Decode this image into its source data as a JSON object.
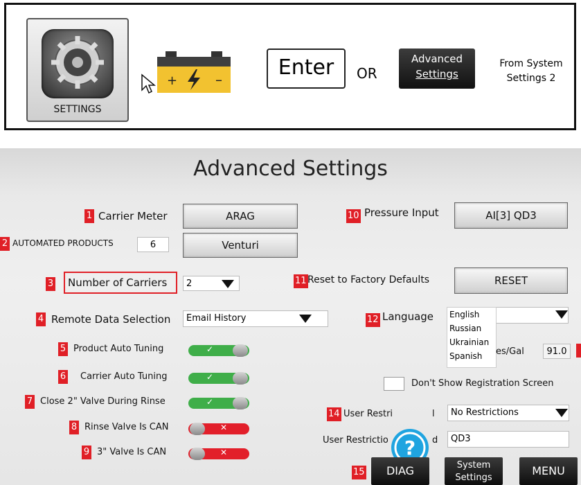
{
  "instructions": {
    "settings_tile_label": "SETTINGS",
    "enter_key": "Enter",
    "or_label": "OR",
    "advanced_btn_line1": "Advanced",
    "advanced_btn_line2": "Settings",
    "from_system_line1": "From System",
    "from_system_line2": "Settings 2",
    "icons": [
      "settings-gear-icon",
      "cursor-arrow-icon",
      "battery-icon"
    ]
  },
  "panel": {
    "title": "Advanced Settings",
    "items": {
      "carrier_meter": {
        "num": "1",
        "label": "Carrier Meter",
        "value": "ARAG"
      },
      "automated_products": {
        "num": "2",
        "label": "AUTOMATED PRODUCTS",
        "count": "6",
        "value": "Venturi"
      },
      "number_of_carriers": {
        "num": "3",
        "label": "Number of Carriers",
        "value": "2"
      },
      "remote_data": {
        "num": "4",
        "label": "Remote Data Selection",
        "value": "Email History"
      },
      "product_auto_tuning": {
        "num": "5",
        "label": "Product Auto Tuning",
        "state": "on"
      },
      "carrier_auto_tuning": {
        "num": "6",
        "label": "Carrier Auto Tuning",
        "state": "on"
      },
      "close_valve": {
        "num": "7",
        "label": "Close 2\" Valve During Rinse",
        "state": "on"
      },
      "rinse_valve": {
        "num": "8",
        "label": "Rinse Valve Is CAN",
        "state": "off"
      },
      "valve3": {
        "num": "9",
        "label": "3\" Valve Is CAN",
        "state": "off"
      },
      "pressure_input": {
        "num": "10",
        "label": "Pressure Input",
        "value": "AI[3]  QD3"
      },
      "reset": {
        "num": "11",
        "label": "Reset to Factory Defaults",
        "button": "RESET"
      },
      "language": {
        "num": "12",
        "label": "Language",
        "options": [
          "English",
          "Russian",
          "Ukrainian",
          "Spanish"
        ]
      },
      "gal": {
        "label_tail": "es/Gal",
        "value": "91.0"
      },
      "registration": {
        "label": "Don't Show Registration Screen"
      },
      "user_restriction_level": {
        "num": "14",
        "label_head": "User Restri",
        "label_tail": "l",
        "value": "No Restrictions"
      },
      "user_restriction_password": {
        "label_head": "User Restrictio",
        "label_tail": "d",
        "value": "QD3"
      },
      "diag": {
        "num": "15",
        "label": "DIAG"
      },
      "system_settings": {
        "line1": "System",
        "line2": "Settings"
      },
      "menu": {
        "label": "MENU"
      }
    }
  },
  "colors": {
    "accent_red": "#e01f26",
    "toggle_on": "#3fae49",
    "toggle_off": "#e21f2a",
    "help_blue": "#1fa4e0"
  }
}
